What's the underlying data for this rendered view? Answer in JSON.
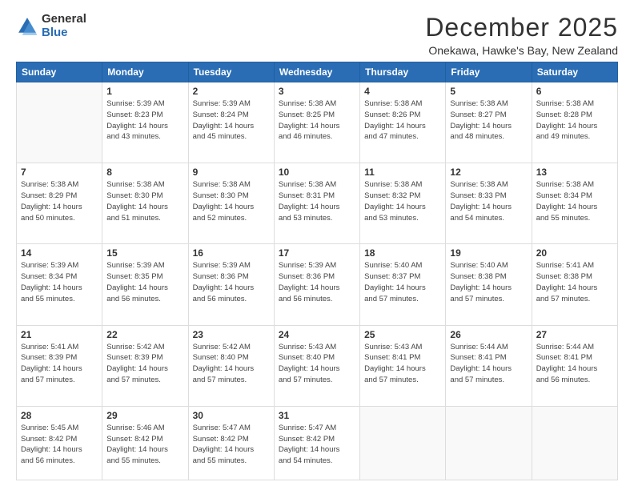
{
  "logo": {
    "general": "General",
    "blue": "Blue"
  },
  "header": {
    "month": "December 2025",
    "location": "Onekawa, Hawke's Bay, New Zealand"
  },
  "weekdays": [
    "Sunday",
    "Monday",
    "Tuesday",
    "Wednesday",
    "Thursday",
    "Friday",
    "Saturday"
  ],
  "weeks": [
    [
      {
        "day": "",
        "info": ""
      },
      {
        "day": "1",
        "info": "Sunrise: 5:39 AM\nSunset: 8:23 PM\nDaylight: 14 hours\nand 43 minutes."
      },
      {
        "day": "2",
        "info": "Sunrise: 5:39 AM\nSunset: 8:24 PM\nDaylight: 14 hours\nand 45 minutes."
      },
      {
        "day": "3",
        "info": "Sunrise: 5:38 AM\nSunset: 8:25 PM\nDaylight: 14 hours\nand 46 minutes."
      },
      {
        "day": "4",
        "info": "Sunrise: 5:38 AM\nSunset: 8:26 PM\nDaylight: 14 hours\nand 47 minutes."
      },
      {
        "day": "5",
        "info": "Sunrise: 5:38 AM\nSunset: 8:27 PM\nDaylight: 14 hours\nand 48 minutes."
      },
      {
        "day": "6",
        "info": "Sunrise: 5:38 AM\nSunset: 8:28 PM\nDaylight: 14 hours\nand 49 minutes."
      }
    ],
    [
      {
        "day": "7",
        "info": "Sunrise: 5:38 AM\nSunset: 8:29 PM\nDaylight: 14 hours\nand 50 minutes."
      },
      {
        "day": "8",
        "info": "Sunrise: 5:38 AM\nSunset: 8:30 PM\nDaylight: 14 hours\nand 51 minutes."
      },
      {
        "day": "9",
        "info": "Sunrise: 5:38 AM\nSunset: 8:30 PM\nDaylight: 14 hours\nand 52 minutes."
      },
      {
        "day": "10",
        "info": "Sunrise: 5:38 AM\nSunset: 8:31 PM\nDaylight: 14 hours\nand 53 minutes."
      },
      {
        "day": "11",
        "info": "Sunrise: 5:38 AM\nSunset: 8:32 PM\nDaylight: 14 hours\nand 53 minutes."
      },
      {
        "day": "12",
        "info": "Sunrise: 5:38 AM\nSunset: 8:33 PM\nDaylight: 14 hours\nand 54 minutes."
      },
      {
        "day": "13",
        "info": "Sunrise: 5:38 AM\nSunset: 8:34 PM\nDaylight: 14 hours\nand 55 minutes."
      }
    ],
    [
      {
        "day": "14",
        "info": "Sunrise: 5:39 AM\nSunset: 8:34 PM\nDaylight: 14 hours\nand 55 minutes."
      },
      {
        "day": "15",
        "info": "Sunrise: 5:39 AM\nSunset: 8:35 PM\nDaylight: 14 hours\nand 56 minutes."
      },
      {
        "day": "16",
        "info": "Sunrise: 5:39 AM\nSunset: 8:36 PM\nDaylight: 14 hours\nand 56 minutes."
      },
      {
        "day": "17",
        "info": "Sunrise: 5:39 AM\nSunset: 8:36 PM\nDaylight: 14 hours\nand 56 minutes."
      },
      {
        "day": "18",
        "info": "Sunrise: 5:40 AM\nSunset: 8:37 PM\nDaylight: 14 hours\nand 57 minutes."
      },
      {
        "day": "19",
        "info": "Sunrise: 5:40 AM\nSunset: 8:38 PM\nDaylight: 14 hours\nand 57 minutes."
      },
      {
        "day": "20",
        "info": "Sunrise: 5:41 AM\nSunset: 8:38 PM\nDaylight: 14 hours\nand 57 minutes."
      }
    ],
    [
      {
        "day": "21",
        "info": "Sunrise: 5:41 AM\nSunset: 8:39 PM\nDaylight: 14 hours\nand 57 minutes."
      },
      {
        "day": "22",
        "info": "Sunrise: 5:42 AM\nSunset: 8:39 PM\nDaylight: 14 hours\nand 57 minutes."
      },
      {
        "day": "23",
        "info": "Sunrise: 5:42 AM\nSunset: 8:40 PM\nDaylight: 14 hours\nand 57 minutes."
      },
      {
        "day": "24",
        "info": "Sunrise: 5:43 AM\nSunset: 8:40 PM\nDaylight: 14 hours\nand 57 minutes."
      },
      {
        "day": "25",
        "info": "Sunrise: 5:43 AM\nSunset: 8:41 PM\nDaylight: 14 hours\nand 57 minutes."
      },
      {
        "day": "26",
        "info": "Sunrise: 5:44 AM\nSunset: 8:41 PM\nDaylight: 14 hours\nand 57 minutes."
      },
      {
        "day": "27",
        "info": "Sunrise: 5:44 AM\nSunset: 8:41 PM\nDaylight: 14 hours\nand 56 minutes."
      }
    ],
    [
      {
        "day": "28",
        "info": "Sunrise: 5:45 AM\nSunset: 8:42 PM\nDaylight: 14 hours\nand 56 minutes."
      },
      {
        "day": "29",
        "info": "Sunrise: 5:46 AM\nSunset: 8:42 PM\nDaylight: 14 hours\nand 55 minutes."
      },
      {
        "day": "30",
        "info": "Sunrise: 5:47 AM\nSunset: 8:42 PM\nDaylight: 14 hours\nand 55 minutes."
      },
      {
        "day": "31",
        "info": "Sunrise: 5:47 AM\nSunset: 8:42 PM\nDaylight: 14 hours\nand 54 minutes."
      },
      {
        "day": "",
        "info": ""
      },
      {
        "day": "",
        "info": ""
      },
      {
        "day": "",
        "info": ""
      }
    ]
  ]
}
